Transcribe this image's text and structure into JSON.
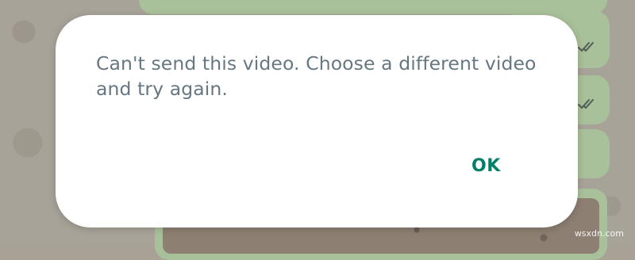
{
  "dialog": {
    "message": "Can't send this video. Choose a different video and try again.",
    "ok_label": "OK"
  },
  "colors": {
    "dialog_text": "#667781",
    "accent": "#008069",
    "bubble": "#a9c19a"
  },
  "icons": {
    "read_receipt": "double-check-icon"
  },
  "watermark": "wsxdn.com"
}
